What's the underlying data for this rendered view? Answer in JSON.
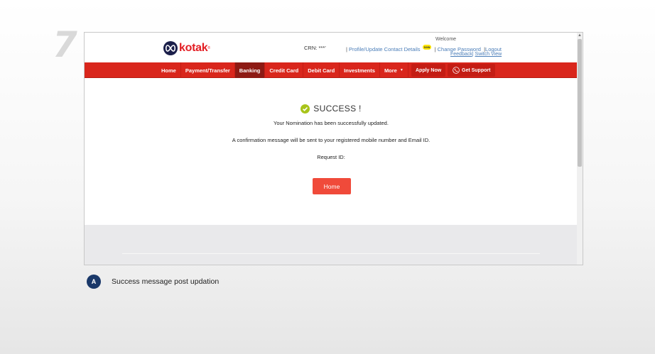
{
  "step": {
    "number": "7"
  },
  "header": {
    "logo_text": "kotak",
    "logo_reg": "®",
    "crn_label": "CRN:",
    "crn_value": "***'",
    "profile_link": "Profile/Update Contact Details",
    "new_badge": "new",
    "change_password_link": "Change Password",
    "logout_link": "Logout",
    "welcome": "Welcome",
    "feedback_link": "Feedback",
    "switch_view_link": "Switch View"
  },
  "nav": {
    "items": [
      {
        "label": "Home"
      },
      {
        "label": "Payment/Transfer"
      },
      {
        "label": "Banking",
        "active": true
      },
      {
        "label": "Credit Card"
      },
      {
        "label": "Debit Card"
      },
      {
        "label": "Investments"
      },
      {
        "label": "More"
      }
    ],
    "apply_now": "Apply Now",
    "get_support": "Get Support"
  },
  "content": {
    "success_title": "SUCCESS !",
    "message_1": "Your Nomination has been successfully updated.",
    "message_2": "A confirmation message will be sent to your registered mobile number and Email ID.",
    "request_id_label": "Request ID:",
    "home_button": "Home"
  },
  "caption": {
    "badge": "A",
    "text": "Success message post updation"
  },
  "colors": {
    "brand_red": "#d9261c",
    "active_nav": "#8d1a14",
    "home_button": "#f04a3a",
    "logo_navy": "#1b1f4a",
    "success_check": "#a8c41a",
    "caption_badge": "#1a3869",
    "link_blue": "#4a7db8"
  }
}
